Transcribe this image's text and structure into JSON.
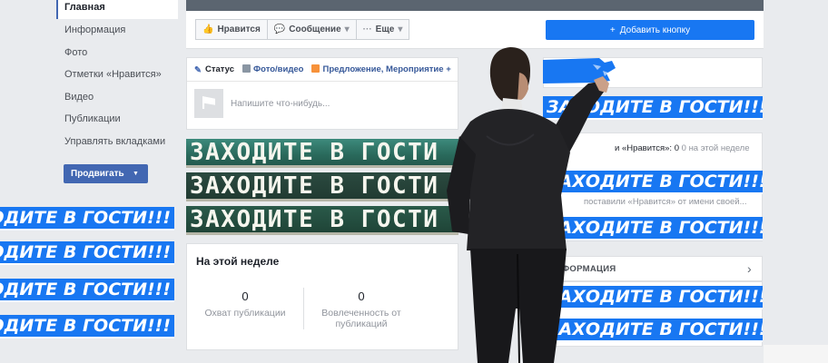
{
  "sidebar": {
    "items": [
      {
        "label": "Главная",
        "active": true
      },
      {
        "label": "Информация"
      },
      {
        "label": "Фото"
      },
      {
        "label": "Отметки «Нравится»"
      },
      {
        "label": "Видео"
      },
      {
        "label": "Публикации"
      },
      {
        "label": "Управлять вкладками"
      }
    ],
    "promote_label": "Продвигать"
  },
  "actions": {
    "like_label": "Нравится",
    "message_label": "Сообщение",
    "more_label": "Еще",
    "add_button_label": "Добавить кнопку"
  },
  "composer": {
    "tabs": [
      "Статус",
      "Фото/видео",
      "Предложение, Мероприятие +"
    ],
    "placeholder": "Напишите что-нибудь..."
  },
  "chalk_banner_text": "ЗАХОДИТЕ В ГОСТИ",
  "banner_text": "ЗАХОДИТЕ В ГОСТИ!!!",
  "left_banner_text": "ОДИТЕ В ГОСТИ!!!",
  "this_week": {
    "title": "На этой неделе",
    "metrics": [
      {
        "value": "0",
        "label": "Охват публикации"
      },
      {
        "value": "0",
        "label": "Вовлеченность от публикаций"
      }
    ]
  },
  "right": {
    "likes_text": "и «Нравится»: 0",
    "likes_suffix": "0 на этой неделе",
    "liked_as_page": "поставили «Нравится» от имени своей...",
    "info_head": "ФОРМАЦИЯ"
  },
  "colors": {
    "fb_blue": "#4267b2",
    "banner_blue": "#1877f2",
    "background": "#e9ebee"
  }
}
